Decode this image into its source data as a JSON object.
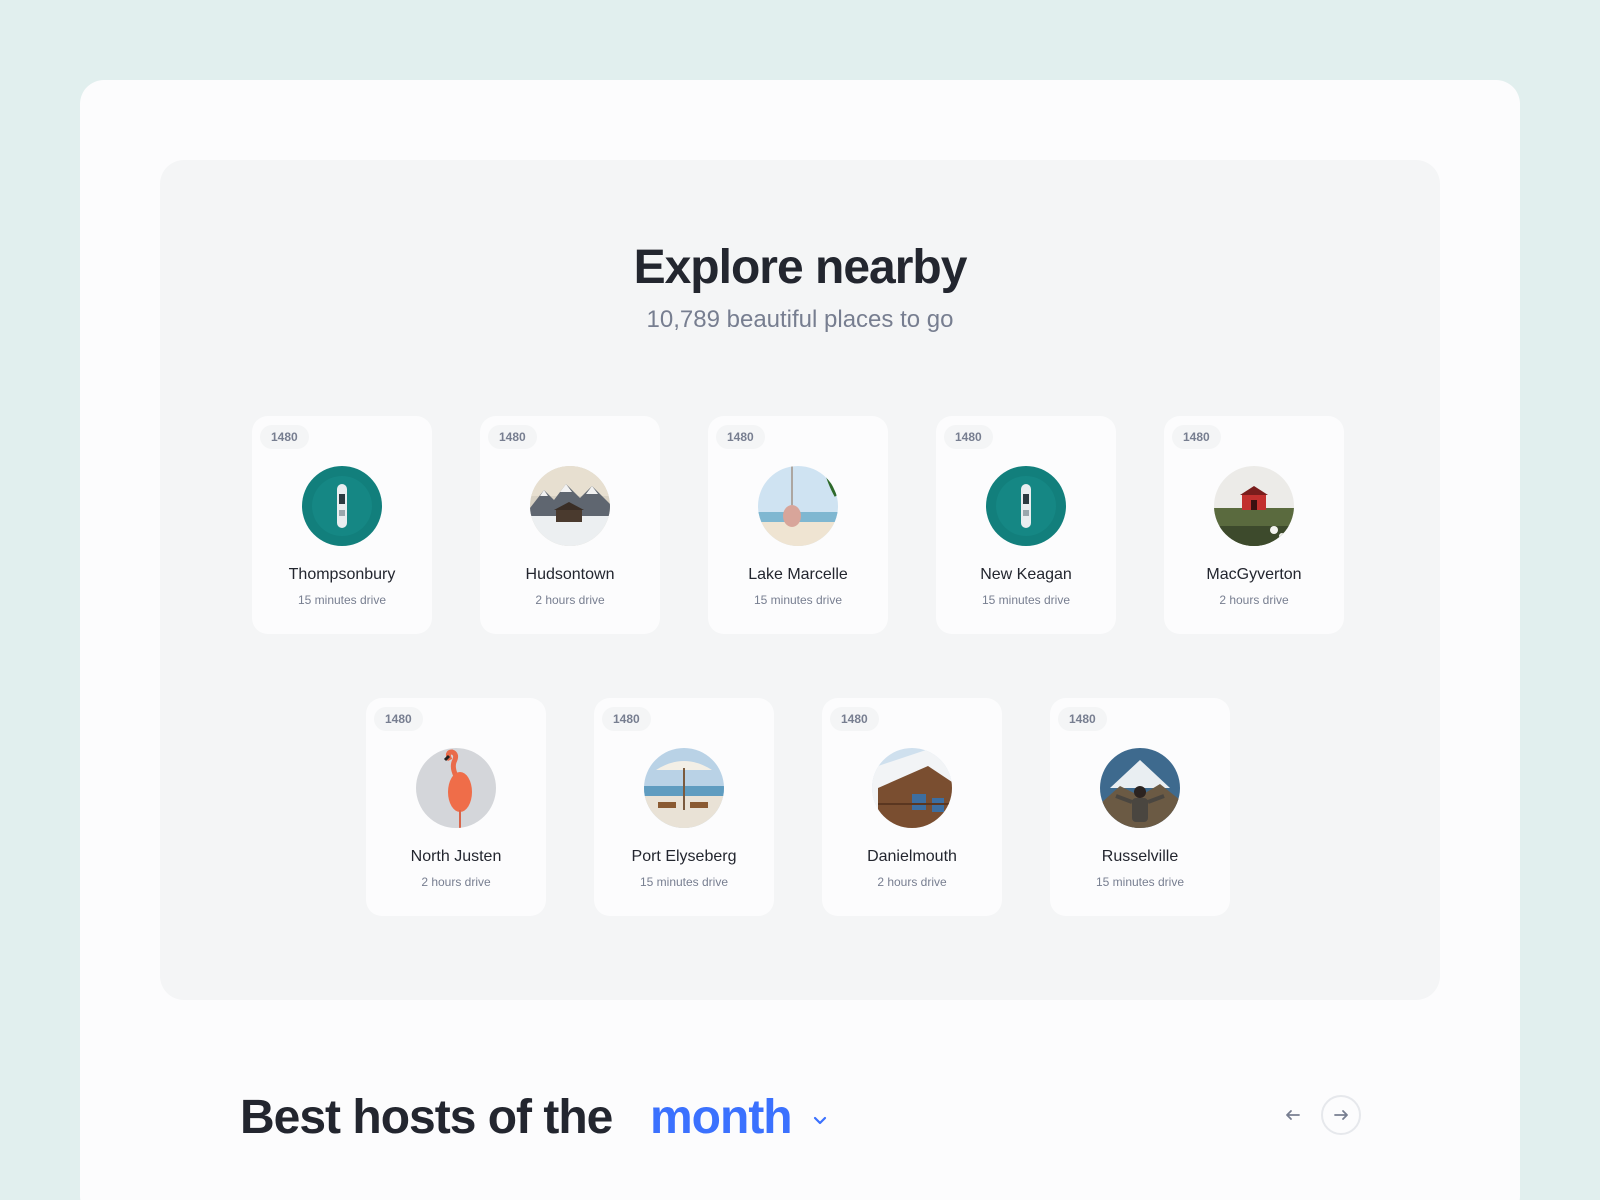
{
  "explore": {
    "title": "Explore nearby",
    "subtitle": "10,789 beautiful places to go"
  },
  "places": [
    {
      "badge": "1480",
      "name": "Thompsonbury",
      "distance": "15 minutes drive",
      "image_icon": "boat-aerial-image"
    },
    {
      "badge": "1480",
      "name": "Hudsontown",
      "distance": "2 hours drive",
      "image_icon": "snowy-mountain-image"
    },
    {
      "badge": "1480",
      "name": "Lake Marcelle",
      "distance": "15 minutes drive",
      "image_icon": "beach-swing-image"
    },
    {
      "badge": "1480",
      "name": "New Keagan",
      "distance": "15 minutes drive",
      "image_icon": "boat-aerial-image"
    },
    {
      "badge": "1480",
      "name": "MacGyverton",
      "distance": "2 hours drive",
      "image_icon": "red-house-image"
    },
    {
      "badge": "1480",
      "name": "North Justen",
      "distance": "2 hours drive",
      "image_icon": "flamingo-image"
    },
    {
      "badge": "1480",
      "name": "Port Elyseberg",
      "distance": "15 minutes drive",
      "image_icon": "beach-umbrella-image"
    },
    {
      "badge": "1480",
      "name": "Danielmouth",
      "distance": "2 hours drive",
      "image_icon": "wooden-cabin-image"
    },
    {
      "badge": "1480",
      "name": "Russelville",
      "distance": "15 minutes drive",
      "image_icon": "hiker-mountain-image"
    }
  ],
  "hosts": {
    "title": "Best hosts of the",
    "period": "month",
    "prev_icon": "arrow-left-icon",
    "next_icon": "arrow-right-icon"
  },
  "colors": {
    "background": "#e1efee",
    "accent": "#3b71fe",
    "text": "#23262f",
    "muted": "#777e90"
  }
}
